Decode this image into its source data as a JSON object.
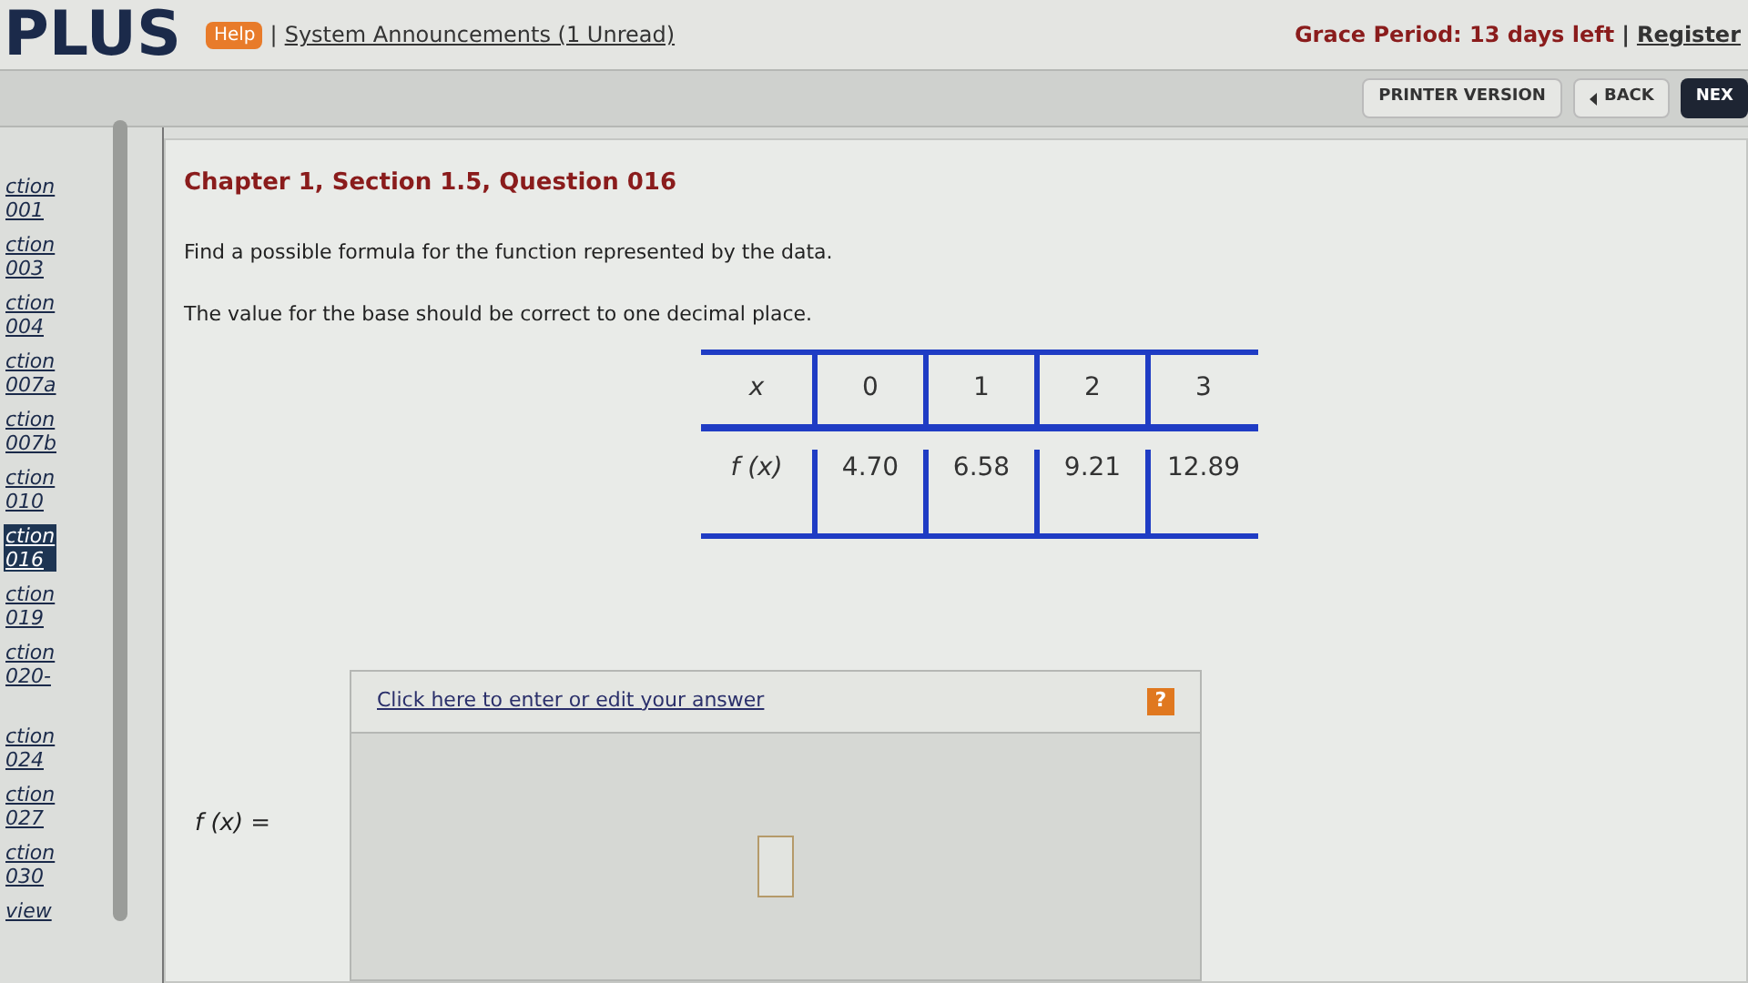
{
  "header": {
    "logo": "PLUS",
    "help": "Help",
    "separator": "|",
    "announcements": "System Announcements (1 Unread)",
    "grace": "Grace Period: 13 days left",
    "separator2": "|",
    "register": "Register"
  },
  "toolbar": {
    "buttons": [
      {
        "label": "PRINTER VERSION",
        "kind": "plain"
      },
      {
        "label": "BACK",
        "kind": "back"
      },
      {
        "label": "NEX",
        "kind": "dark"
      }
    ]
  },
  "sidebar": {
    "items": [
      {
        "line1": "ction",
        "line2": "001",
        "selected": false
      },
      {
        "line1": "ction",
        "line2": "003",
        "selected": false
      },
      {
        "line1": "ction",
        "line2": "004",
        "selected": false
      },
      {
        "line1": "ction",
        "line2": "007a",
        "selected": false
      },
      {
        "line1": "ction",
        "line2": "007b",
        "selected": false
      },
      {
        "line1": "ction",
        "line2": "010",
        "selected": false
      },
      {
        "line1": "ction",
        "line2": "016",
        "selected": true
      },
      {
        "line1": "ction",
        "line2": "019",
        "selected": false
      },
      {
        "line1": "ction",
        "line2": "020-",
        "selected": false
      },
      {
        "line1": "ction",
        "line2": "024",
        "selected": false
      },
      {
        "line1": "ction",
        "line2": "027",
        "selected": false
      },
      {
        "line1": "ction",
        "line2": "030",
        "selected": false
      },
      {
        "line1": "view",
        "selected": false
      }
    ]
  },
  "question": {
    "title": "Chapter 1, Section 1.5, Question 016",
    "prompt": "Find a possible formula for the function represented by the data.",
    "note": "The value for the base should be correct to one decimal place.",
    "table": {
      "header": [
        "x",
        "0",
        "1",
        "2",
        "3"
      ],
      "row": [
        "f (x)",
        "4.70",
        "6.58",
        "9.21",
        "12.89"
      ]
    }
  },
  "answer": {
    "link": "Click here to enter or edit your answer",
    "help": "?",
    "label": "f (x) ="
  }
}
